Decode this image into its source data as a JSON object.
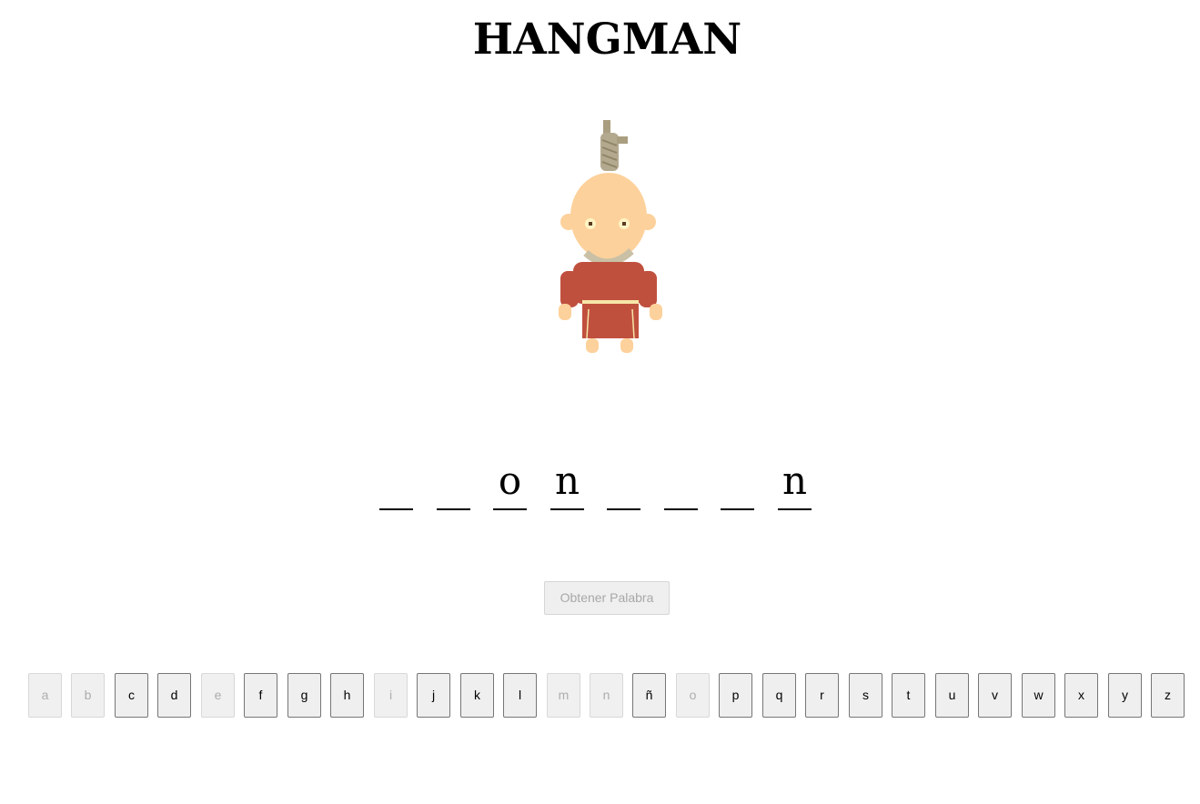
{
  "title": "HANGMAN",
  "word": {
    "slots": [
      "",
      "",
      "o",
      "n",
      "",
      "",
      "",
      "n"
    ]
  },
  "get_word_button": "Obtener Palabra",
  "keyboard": {
    "keys": [
      {
        "letter": "a",
        "used": true
      },
      {
        "letter": "b",
        "used": true
      },
      {
        "letter": "c",
        "used": false
      },
      {
        "letter": "d",
        "used": false
      },
      {
        "letter": "e",
        "used": true
      },
      {
        "letter": "f",
        "used": false
      },
      {
        "letter": "g",
        "used": false
      },
      {
        "letter": "h",
        "used": false
      },
      {
        "letter": "i",
        "used": true
      },
      {
        "letter": "j",
        "used": false
      },
      {
        "letter": "k",
        "used": false
      },
      {
        "letter": "l",
        "used": false
      },
      {
        "letter": "m",
        "used": true
      },
      {
        "letter": "n",
        "used": true
      },
      {
        "letter": "ñ",
        "used": false
      },
      {
        "letter": "o",
        "used": true
      },
      {
        "letter": "p",
        "used": false
      },
      {
        "letter": "q",
        "used": false
      },
      {
        "letter": "r",
        "used": false
      },
      {
        "letter": "s",
        "used": false
      },
      {
        "letter": "t",
        "used": false
      },
      {
        "letter": "u",
        "used": false
      },
      {
        "letter": "v",
        "used": false
      },
      {
        "letter": "w",
        "used": false
      },
      {
        "letter": "x",
        "used": false
      },
      {
        "letter": "y",
        "used": false
      },
      {
        "letter": "z",
        "used": false
      }
    ]
  },
  "colors": {
    "skin": "#fdd19b",
    "shirt": "#c0503e",
    "rope": "#b3a98e",
    "belt": "#f6e6a8"
  },
  "icons": {
    "figure": "hanged-man-icon"
  }
}
